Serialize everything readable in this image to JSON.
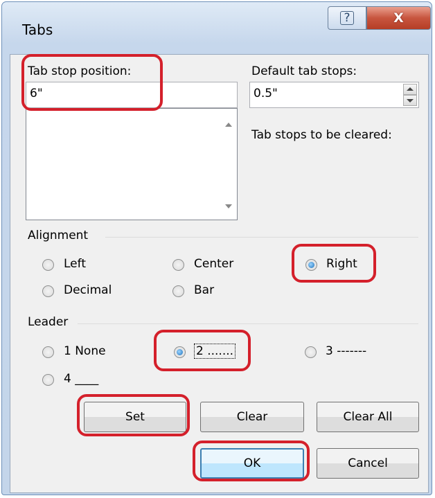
{
  "window": {
    "title": "Tabs",
    "help_glyph": "?",
    "close_glyph": "X"
  },
  "tab_stop": {
    "label": "Tab stop position:",
    "value": "6\""
  },
  "default_tab_stops": {
    "label": "Default tab stops:",
    "value": "0.5\""
  },
  "to_be_cleared_label": "Tab stops to be cleared:",
  "alignment": {
    "group_label": "Alignment",
    "options": [
      {
        "label": "Left",
        "checked": false
      },
      {
        "label": "Center",
        "checked": false
      },
      {
        "label": "Right",
        "checked": true
      },
      {
        "label": "Decimal",
        "checked": false
      },
      {
        "label": "Bar",
        "checked": false
      }
    ]
  },
  "leader": {
    "group_label": "Leader",
    "options": [
      {
        "label": "1 None",
        "checked": false
      },
      {
        "label": "2 .......",
        "checked": true
      },
      {
        "label": "3 -------",
        "checked": false
      },
      {
        "label": "4 ____",
        "checked": false
      }
    ]
  },
  "buttons": {
    "set": "Set",
    "clear": "Clear",
    "clear_all": "Clear All",
    "ok": "OK",
    "cancel": "Cancel"
  },
  "highlight_color": "#d4202b"
}
